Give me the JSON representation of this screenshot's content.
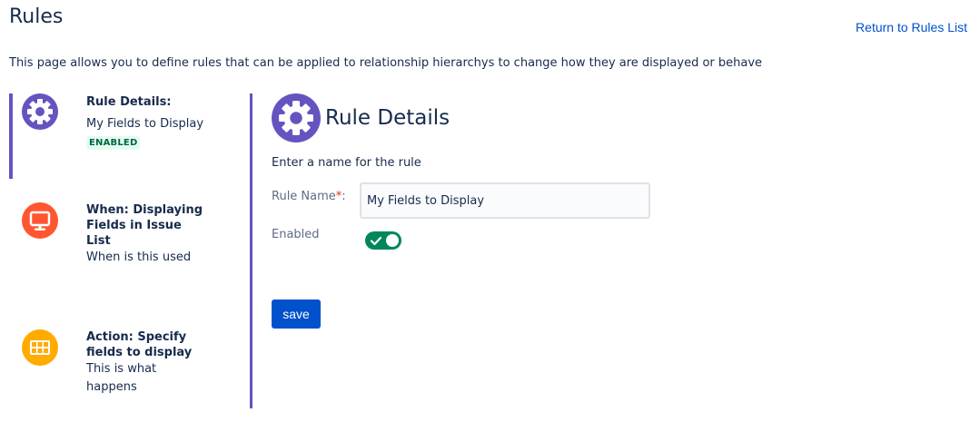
{
  "header": {
    "title": "Rules",
    "return_link": "Return to Rules List",
    "description": "This page allows you to define rules that can be applied to relationship hierarchys to change how they are displayed or behave"
  },
  "steps": [
    {
      "title": "Rule Details:",
      "desc": "My Fields to Display",
      "badge": "ENABLED",
      "icon": "gear-icon",
      "color": "#6554c0"
    },
    {
      "title": "When: Displaying Fields in Issue List",
      "desc": "When is this used",
      "icon": "monitor-icon",
      "color": "#ff5630"
    },
    {
      "title": "Action: Specify fields to display",
      "desc": "This is what happens",
      "icon": "table-grid-icon",
      "color": "#ffab00"
    }
  ],
  "main": {
    "title": "Rule Details",
    "intro": "Enter a name for the rule",
    "rule_name_label": "Rule Name",
    "required_marker": "*",
    "rule_name_suffix": ":",
    "rule_name_value": "My Fields to Display",
    "enabled_label": "Enabled",
    "enabled": true,
    "save_label": "save"
  },
  "colors": {
    "accent": "#6554c0",
    "primary": "#0052cc",
    "success": "#00875a"
  }
}
